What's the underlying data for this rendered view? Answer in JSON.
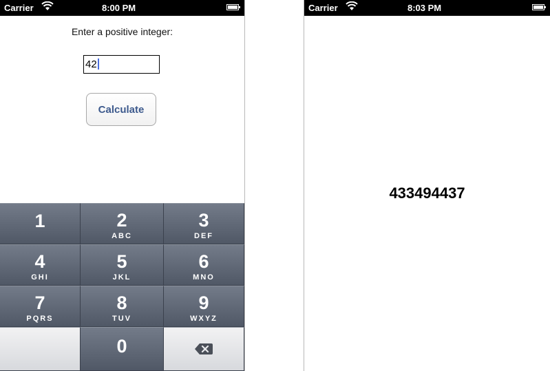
{
  "left_screen": {
    "status": {
      "carrier": "Carrier",
      "time": "8:00 PM"
    },
    "prompt": "Enter a positive integer:",
    "input_value": "42",
    "button_label": "Calculate",
    "keypad": {
      "keys": [
        {
          "digit": "1",
          "letters": ""
        },
        {
          "digit": "2",
          "letters": "ABC"
        },
        {
          "digit": "3",
          "letters": "DEF"
        },
        {
          "digit": "4",
          "letters": "GHI"
        },
        {
          "digit": "5",
          "letters": "JKL"
        },
        {
          "digit": "6",
          "letters": "MNO"
        },
        {
          "digit": "7",
          "letters": "PQRS"
        },
        {
          "digit": "8",
          "letters": "TUV"
        },
        {
          "digit": "9",
          "letters": "WXYZ"
        },
        {
          "digit": "",
          "letters": ""
        },
        {
          "digit": "0",
          "letters": ""
        },
        {
          "digit": "",
          "letters": ""
        }
      ],
      "delete_icon": "backspace-icon"
    }
  },
  "right_screen": {
    "status": {
      "carrier": "Carrier",
      "time": "8:03 PM"
    },
    "result": "433494437"
  }
}
